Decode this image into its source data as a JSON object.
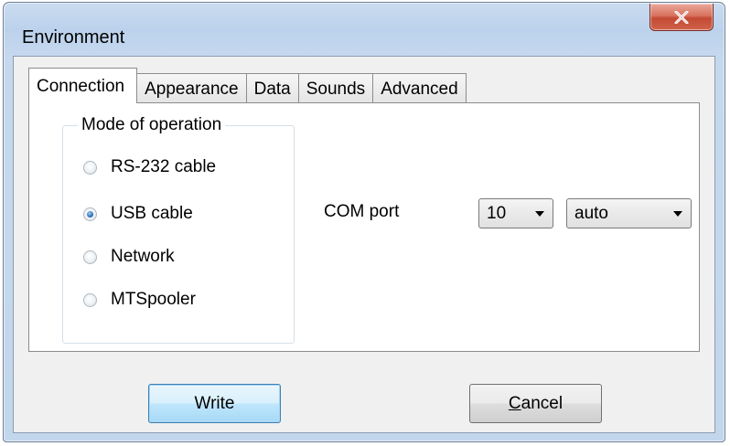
{
  "window": {
    "title": "Environment",
    "close_icon": "close-x-icon"
  },
  "tabs": [
    {
      "label": "Connection",
      "active": true
    },
    {
      "label": "Appearance",
      "active": false
    },
    {
      "label": "Data",
      "active": false
    },
    {
      "label": "Sounds",
      "active": false
    },
    {
      "label": "Advanced",
      "active": false
    }
  ],
  "mode_group": {
    "legend": "Mode of operation",
    "options": [
      {
        "label": "RS-232 cable",
        "checked": false
      },
      {
        "label": "USB cable",
        "checked": true
      },
      {
        "label": "Network",
        "checked": false
      },
      {
        "label": "MTSpooler",
        "checked": false
      }
    ]
  },
  "com_port": {
    "label": "COM port",
    "port_value": "10",
    "speed_value": "auto"
  },
  "buttons": {
    "write_label": "Write",
    "cancel_first": "C",
    "cancel_rest": "ancel"
  },
  "colors": {
    "close_button": "#c44a34",
    "default_button_border": "#3c7fb1",
    "radio_checked": "#2c6fb3"
  }
}
